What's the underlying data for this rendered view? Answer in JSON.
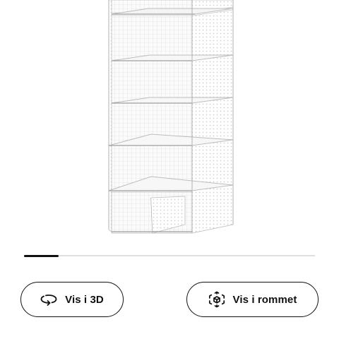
{
  "product": {
    "image": "white-hanging-closet-organizer-with-shelves-and-compartments"
  },
  "carousel": {
    "position_fraction": 0.12
  },
  "actions": {
    "view_3d": {
      "label": "Vis i 3D",
      "icon": "rotate-3d-icon"
    },
    "view_in_room": {
      "label": "Vis i rommet",
      "icon": "ar-cube-icon"
    }
  },
  "colors": {
    "text": "#111111",
    "track": "#dfdfdf",
    "background": "#ffffff"
  }
}
